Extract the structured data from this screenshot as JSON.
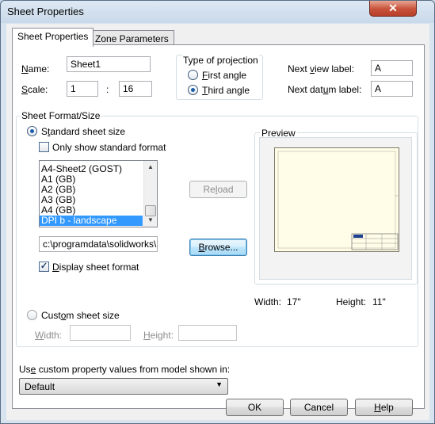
{
  "window": {
    "title": "Sheet Properties",
    "close_glyph": "✕"
  },
  "tabs": [
    {
      "label": "Sheet Properties",
      "active": true
    },
    {
      "label": "Zone Parameters",
      "active": false
    }
  ],
  "name": {
    "label": "Name:",
    "value": "Sheet1"
  },
  "scale": {
    "label": "Scale:",
    "numerator": "1",
    "separator": ":",
    "denominator": "16"
  },
  "projection": {
    "title": "Type of projection",
    "options": [
      {
        "label": "First angle",
        "selected": false
      },
      {
        "label": "Third angle",
        "selected": true
      }
    ]
  },
  "next_view_label": {
    "label": "Next view label:",
    "value": "A"
  },
  "next_datum_label": {
    "label": "Next datum label:",
    "value": "A"
  },
  "sheet_format": {
    "group_title": "Sheet Format/Size",
    "standard_option": {
      "label": "Standard sheet size",
      "selected": true
    },
    "only_standard_checkbox": {
      "label": "Only show standard format",
      "checked": false
    },
    "list_items": [
      "A4-Sheet2 (GOST)",
      "A1 (GB)",
      "A2 (GB)",
      "A3 (GB)",
      "A4 (GB)",
      "DPI b - landscape"
    ],
    "selected_item": "DPI b - landscape",
    "reload_label": "Reload",
    "path_value": "c:\\programdata\\solidworks\\",
    "browse_label": "Browse...",
    "display_format_checkbox": {
      "label": "Display sheet format",
      "checked": true,
      "glyph": "✓"
    },
    "custom_option": {
      "label": "Custom sheet size",
      "selected": false
    },
    "width_label": "Width:",
    "height_label": "Height:"
  },
  "preview": {
    "title": "Preview",
    "width_label": "Width:",
    "width_value": "17\"",
    "height_label": "Height:",
    "height_value": "11\""
  },
  "custom_property": {
    "label": "Use custom property values from model shown in:",
    "selected": "Default",
    "arrow_glyph": "▼"
  },
  "buttons": {
    "ok": "OK",
    "cancel": "Cancel",
    "help": "Help"
  },
  "scroll_arrows": {
    "up": "▲",
    "down": "▼"
  },
  "colors": {
    "selection": "#3399ff",
    "window_frame": "#d7e3ef",
    "close_button": "#c7513a"
  }
}
